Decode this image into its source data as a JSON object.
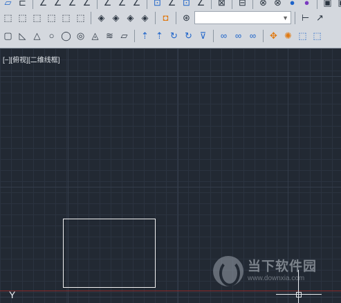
{
  "viewport": {
    "label": "[−][俯视][二维线框]",
    "ucs_label": "Y"
  },
  "toolbar": {
    "layer_combo_value": ""
  },
  "watermark": {
    "title": "当下软件园",
    "url": "www.downxia.com"
  },
  "colors": {
    "background": "#232a34",
    "grid": "#2b3340",
    "x_axis": "#8a2a2a",
    "geometry": "#f4f4f4"
  }
}
